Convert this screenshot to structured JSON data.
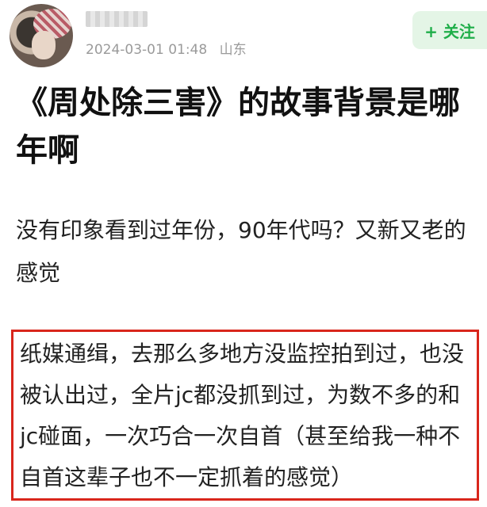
{
  "post": {
    "date": "2024-03-01 01:48",
    "location": "山东",
    "follow_label": "+ 关注",
    "title": "《周处除三害》的故事背景是哪年啊",
    "body": "没有印象看到过年份，90年代吗？又新又老的感觉",
    "highlighted_reply": "纸媒通缉，去那么多地方没监控拍到过，也没被认出过，全片jc都没抓到过，为数不多的和jc碰面，一次巧合一次自首（甚至给我一种不自首这辈子也不一定抓着的感觉）"
  },
  "colors": {
    "accent_green": "#1fae49",
    "follow_bg": "#e4f5e6",
    "highlight_border": "#d9261c",
    "meta_text": "#9a9a9a"
  }
}
